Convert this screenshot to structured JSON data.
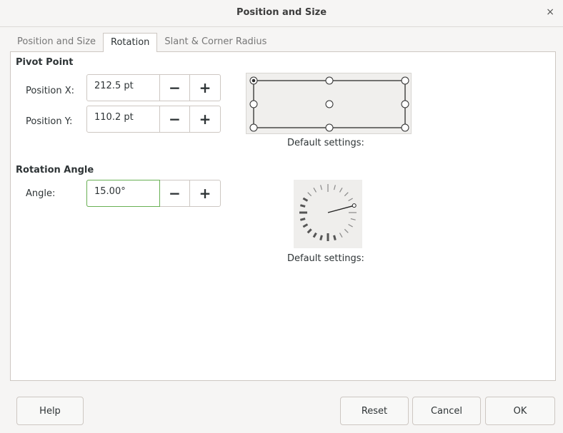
{
  "window": {
    "title": "Position and Size",
    "close_glyph": "×"
  },
  "tabs": [
    {
      "label": "Position and Size",
      "active": false
    },
    {
      "label": "Rotation",
      "active": true
    },
    {
      "label": "Slant & Corner Radius",
      "active": false
    }
  ],
  "pivot": {
    "heading": "Pivot Point",
    "position_x": {
      "label": "Position X:",
      "value": "212.5 pt"
    },
    "position_y": {
      "label": "Position Y:",
      "value": "110.2 pt"
    },
    "selected_point": "top-left",
    "caption": "Default settings:"
  },
  "rotation": {
    "heading": "Rotation Angle",
    "angle": {
      "label": "Angle:",
      "value": "15.00°"
    },
    "caption": "Default settings:"
  },
  "spin_buttons": {
    "minus": "−",
    "plus": "+"
  },
  "buttons": {
    "help": "Help",
    "reset": "Reset",
    "cancel": "Cancel",
    "ok": "OK"
  },
  "colors": {
    "focus_border": "#68b053",
    "active_tab_bg": "#ffffff"
  }
}
